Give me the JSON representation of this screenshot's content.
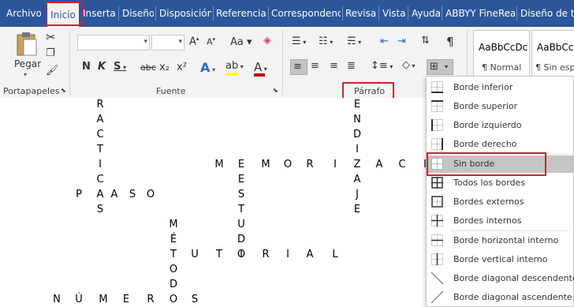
{
  "tabs": [
    "Archivo",
    "Inicio",
    "Insertar",
    "Diseño",
    "Disposición",
    "Referencias",
    "Correspondenci",
    "Revisar",
    "Vista",
    "Ayuda",
    "ABBYY FineReac",
    "Diseño de tab"
  ],
  "active_tab": "Inicio",
  "ribbon": {
    "clipboard": {
      "paste_label": "Pegar",
      "group_label": "Portapapeles"
    },
    "font": {
      "group_label": "Fuente",
      "font_name": "",
      "font_size": "",
      "buttons": [
        "N",
        "K",
        "S",
        "abc",
        "x₂",
        "x²",
        "A",
        "A"
      ]
    },
    "paragraph": {
      "group_label": "Párrafo"
    },
    "styles": {
      "normal_preview": "AaBbCcDc",
      "normal_label": "¶ Normal",
      "nospacing_preview": "AaBbCcI",
      "nospacing_label": "¶ Sin espa"
    }
  },
  "document": {
    "words": [
      "PRACTICAS",
      "PASO",
      "MEMORIZACI",
      "APRENDIZAJE",
      "ESTUDIO",
      "MÉTODOS",
      "TUTORIAL",
      "NÚMEROS"
    ],
    "letters": {
      "practicas_col": [
        "R",
        "A",
        "C",
        "T",
        "I",
        "C",
        "A",
        "S"
      ],
      "paso_row": [
        "P",
        "A",
        "S",
        "O"
      ],
      "memorizaci_row": [
        "M",
        "E",
        "M",
        "O",
        "R",
        "I",
        "Z",
        "A",
        "C",
        "I"
      ],
      "aprendizaje_col": [
        "E",
        "N",
        "D",
        "I",
        "Z",
        "A",
        "J",
        "E"
      ],
      "estudio_col": [
        "E",
        "S",
        "T",
        "U",
        "D",
        "I",
        "O"
      ],
      "metodos_col": [
        "M",
        "É",
        "T",
        "O",
        "D",
        "O",
        "S"
      ],
      "tutorial_row": [
        "U",
        "T",
        "O",
        "R",
        "I",
        "A",
        "L"
      ],
      "numeros_row": [
        "N",
        "Ú",
        "M",
        "E",
        "R",
        "O",
        "S"
      ]
    }
  },
  "border_menu": {
    "items": [
      {
        "label": "Borde inferior",
        "icon": "border-bottom-icon"
      },
      {
        "label": "Borde superior",
        "icon": "border-top-icon"
      },
      {
        "label": "Borde izquierdo",
        "icon": "border-left-icon"
      },
      {
        "label": "Borde derecho",
        "icon": "border-right-icon"
      },
      {
        "label": "Sin borde",
        "icon": "no-border-icon"
      },
      {
        "label": "Todos los bordes",
        "icon": "all-borders-icon"
      },
      {
        "label": "Bordes externos",
        "icon": "outside-borders-icon"
      },
      {
        "label": "Bordes internos",
        "icon": "inside-borders-icon"
      },
      {
        "label": "Borde horizontal interno",
        "icon": "inside-horizontal-border-icon"
      },
      {
        "label": "Borde vertical interno",
        "icon": "inside-vertical-border-icon"
      },
      {
        "label": "Borde diagonal descendente",
        "icon": "diagonal-down-border-icon"
      },
      {
        "label": "Borde diagonal ascendente",
        "icon": "diagonal-up-border-icon"
      }
    ],
    "highlighted": "Sin borde"
  },
  "colors": {
    "tabbar": "#2b579a",
    "highlight": "#c4262e",
    "font_color": "#c00000",
    "text_highlight": "#ffff00"
  }
}
